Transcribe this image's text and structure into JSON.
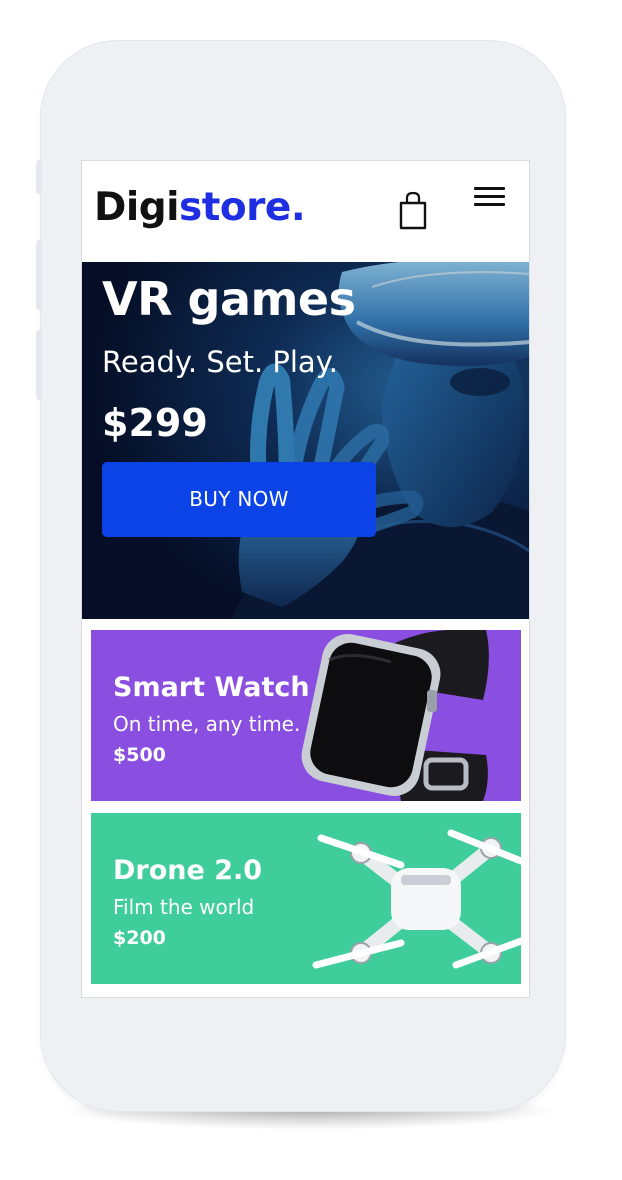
{
  "header": {
    "logo_part1": "Digi",
    "logo_part2": "store.",
    "cart_icon": "shopping-bag-icon",
    "menu_icon": "hamburger-menu-icon"
  },
  "hero": {
    "title": "VR games",
    "tagline": "Ready. Set. Play.",
    "price": "$299",
    "button_label": "BUY NOW",
    "image": "person-wearing-vr-headset"
  },
  "products": [
    {
      "title": "Smart Watch",
      "subtitle": "On time, any time.",
      "price": "$500",
      "image": "smart-watch",
      "background": "#8a4fe0"
    },
    {
      "title": "Drone 2.0",
      "subtitle": "Film the world",
      "price": "$200",
      "image": "quadcopter-drone",
      "background": "#3fce9b"
    }
  ],
  "colors": {
    "brand_blue": "#1d2fe0",
    "button_blue": "#0b43e6",
    "hero_dark": "#0a1530",
    "phone_frame": "#eef0f4"
  }
}
